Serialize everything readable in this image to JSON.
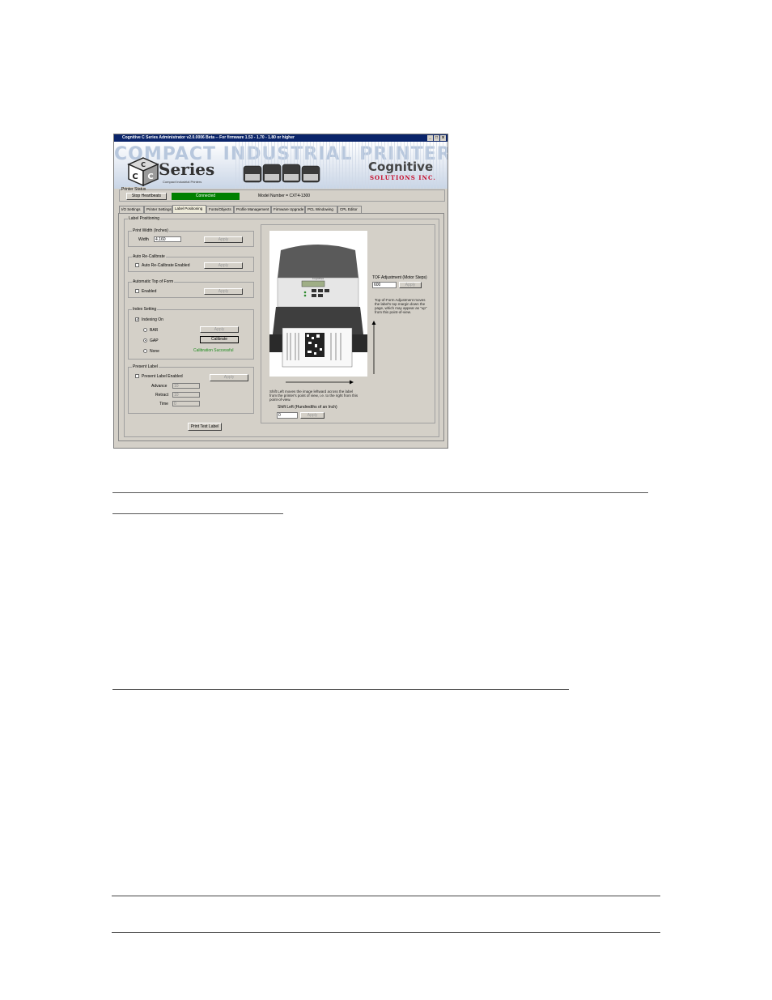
{
  "window": {
    "title": "Cognitive C Series Administrator v2.0.0006 Beta -- For firmware 1.53 - 1.70 - 1.80 or higher",
    "controls": [
      "_",
      "□",
      "x"
    ]
  },
  "banner": {
    "background_text": "COMPACT INDUSTRIAL PRINTERS",
    "series_logo": "Series",
    "series_tagline": "Compact Industrial Printers",
    "brand_name": "Cognitive",
    "brand_sub": "SOLUTIONS INC."
  },
  "status": {
    "group_title": "Printer Status",
    "stop_button": "Stop Heartbeats",
    "connection": "Connected",
    "model": "Model Number = CXT4-1300"
  },
  "tabs": [
    "I/O Settings",
    "Printer Settings",
    "Label Positioning",
    "Fonts/Objects",
    "Profile Management",
    "Firmware Upgrade",
    "PCL Windowing",
    "CPL Editor"
  ],
  "active_tab": "Label Positioning",
  "label_positioning": {
    "group_title": "Label Positioning",
    "print_width": {
      "title": "Print Width (Inches)",
      "width_label": "Width",
      "width_value": "4.160",
      "apply": "Apply"
    },
    "auto_recalibrate": {
      "title": "Auto Re-Calibrate",
      "checkbox_label": "Auto Re-Calibrate Enabled",
      "apply": "Apply"
    },
    "auto_top_of_form": {
      "title": "Automatic Top of Form",
      "checkbox_label": "Enabled",
      "apply": "Apply"
    },
    "index_setting": {
      "title": "Index Setting",
      "indexing_on": "Indexing On",
      "options": [
        "BAR",
        "GAP",
        "None"
      ],
      "selected": "GAP",
      "apply": "Apply",
      "calibrate": "Calibrate",
      "calibration_status": "Calibration Successful"
    },
    "present_label": {
      "title": "Present Label",
      "checkbox_label": "Present Label Enabled",
      "apply": "Apply",
      "advance_label": "Advance",
      "advance_value": "10",
      "retract_label": "Retract",
      "retract_value": "10",
      "time_label": "Time",
      "time_value": "0"
    },
    "print_test_label": "Print Test Label",
    "tof_adjustment": {
      "label": "TOF Adjustment (Motor Steps)",
      "value": "600",
      "apply": "Apply",
      "description": "Top-of-Form Adjustment moves the label's top margin down the page, which may appear as \"up\" from this point-of-view."
    },
    "shift_left": {
      "description": "Shift Left moves the image leftward across the label from the printer's point of view, i.e. to the right from this point-of-view.",
      "label": "Shift Left (Hundredths of an Inch)",
      "value": "0",
      "apply": "Apply"
    },
    "printer_label_text": "Cognitive"
  },
  "colors": {
    "titlebar": "#0a246a",
    "connected": "#008000",
    "calibration_ok": "#1a8a1a",
    "brand_red": "#c8102e"
  }
}
